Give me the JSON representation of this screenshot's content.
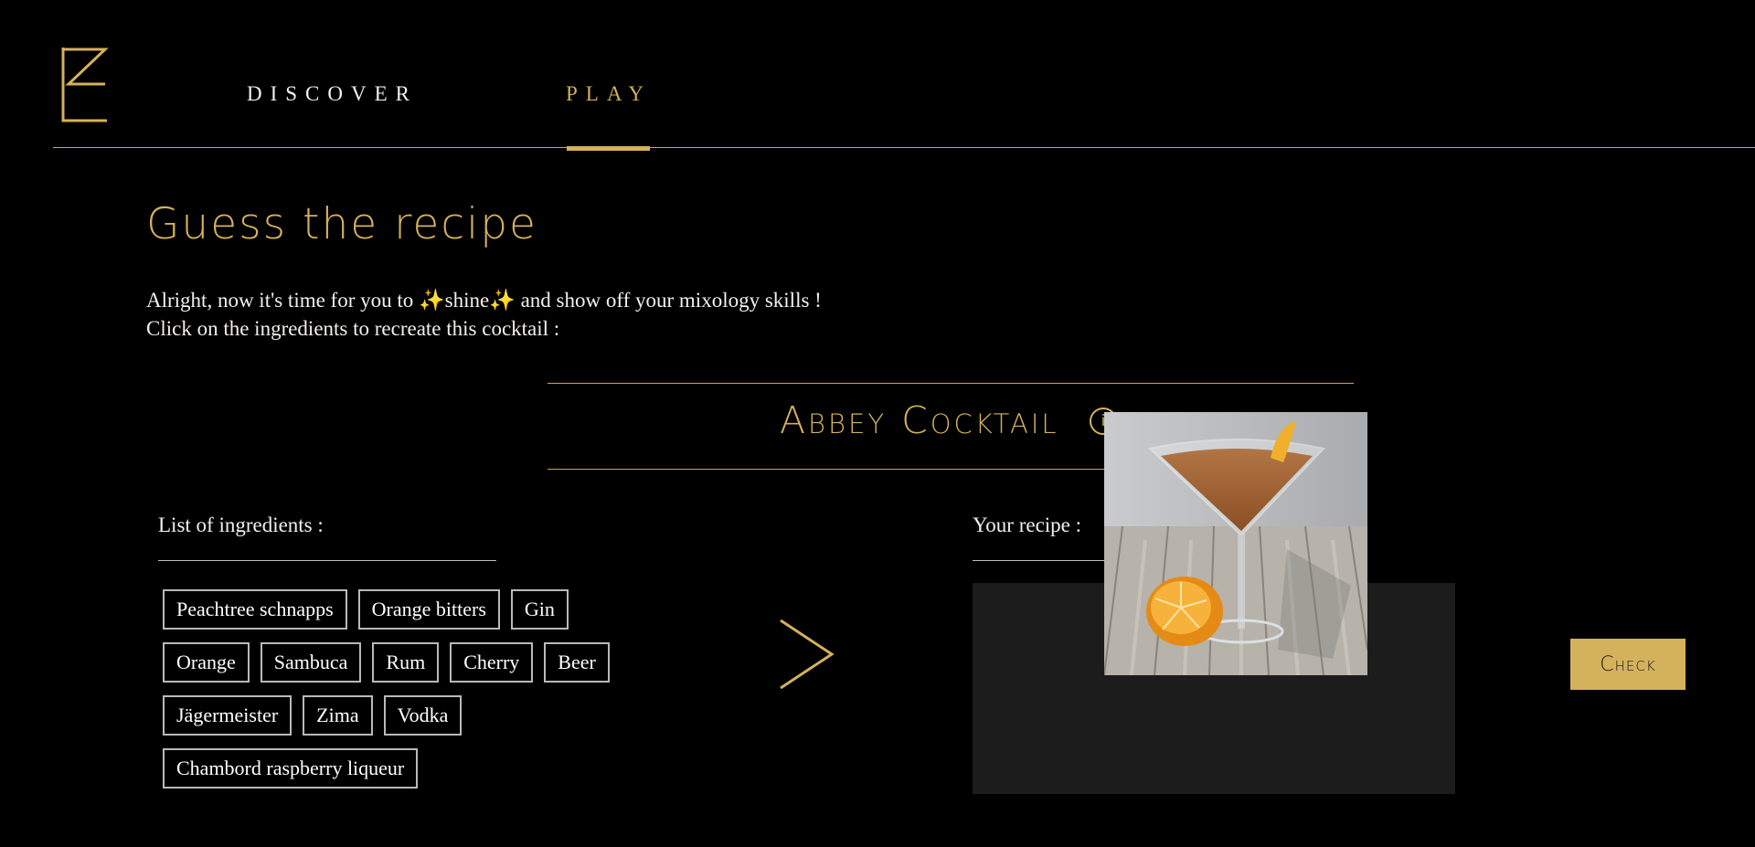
{
  "nav": {
    "logo_icon": "ez-logo-icon",
    "discover_label": "DISCOVER",
    "play_label": "PLAY",
    "active": "PLAY"
  },
  "main": {
    "title": "Guess the recipe",
    "intro_line1": "Alright, now it's time for you to ✨shine✨ and show off your mixology skills !",
    "intro_line2": "Click on the ingredients to recreate this cocktail :",
    "cocktail_name": "Abbey Cocktail",
    "info_icon_glyph": "i",
    "ingredients_label": "List of ingredients :",
    "recipe_label": "Your recipe :",
    "ingredients": [
      "Peachtree schnapps",
      "Orange bitters",
      "Gin",
      "Orange",
      "Sambuca",
      "Rum",
      "Cherry",
      "Beer",
      "Jägermeister",
      "Zima",
      "Vodka",
      "Chambord raspberry liqueur"
    ],
    "arrow_icon": "chevron-right-icon",
    "check_label": "Check"
  },
  "colors": {
    "accent": "#d4b15b",
    "background": "#000000",
    "recipe_box": "#1c1c1c",
    "chip_border": "#b9b9b9"
  }
}
